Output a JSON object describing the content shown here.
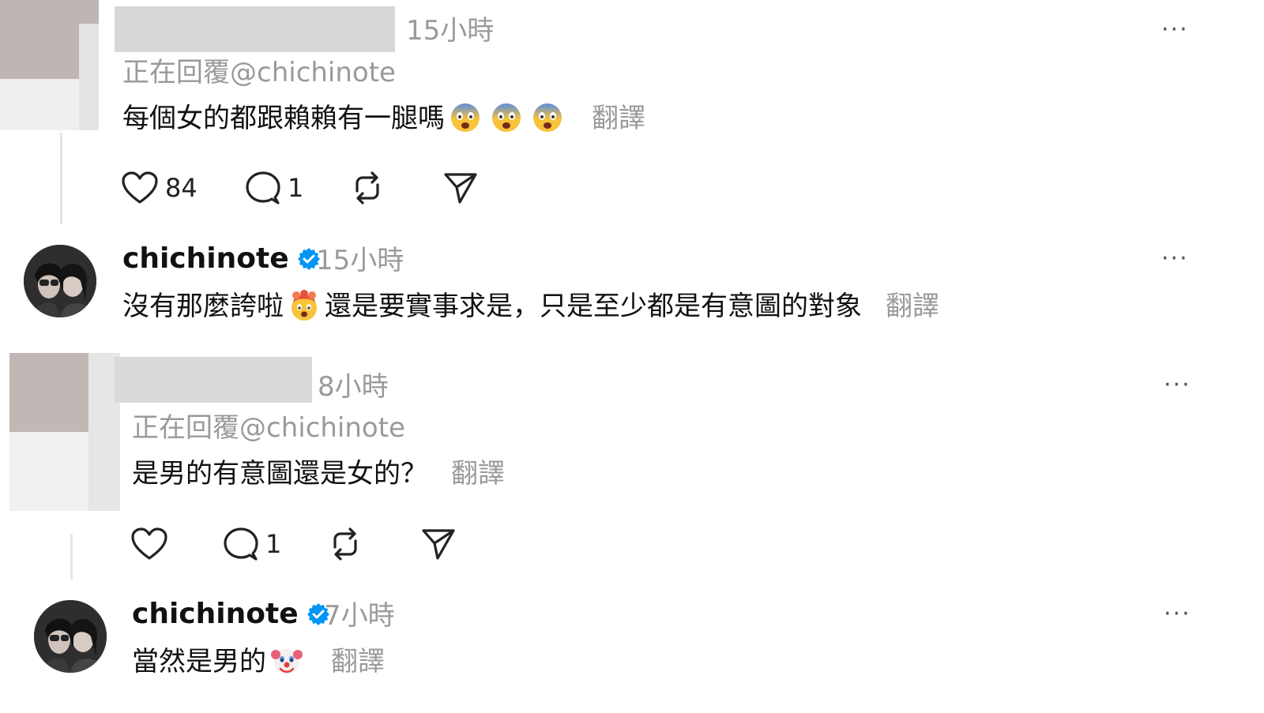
{
  "comments": [
    {
      "time": "15小時",
      "replying": "正在回覆@chichinote",
      "text": "每個女的都跟賴賴有一腿嗎",
      "translate": "翻譯",
      "likes": "84",
      "replies": "1"
    },
    {
      "username": "chichinote",
      "time": "15小時",
      "text_before": "沒有那麼誇啦",
      "text_after": "還是要實事求是，只是至少都是有意圖的對象",
      "translate": "翻譯"
    },
    {
      "time": "8小時",
      "replying": "正在回覆@chichinote",
      "text": "是男的有意圖還是女的？",
      "translate": "翻譯",
      "likes": "",
      "replies": "1"
    },
    {
      "username": "chichinote",
      "time": "7小時",
      "text": "當然是男的",
      "translate": "翻譯"
    }
  ],
  "more_label": "···",
  "colors": {
    "verified": "#0095f6",
    "muted_text": "#9a9a9a",
    "thread_line": "#e4e4e4"
  }
}
